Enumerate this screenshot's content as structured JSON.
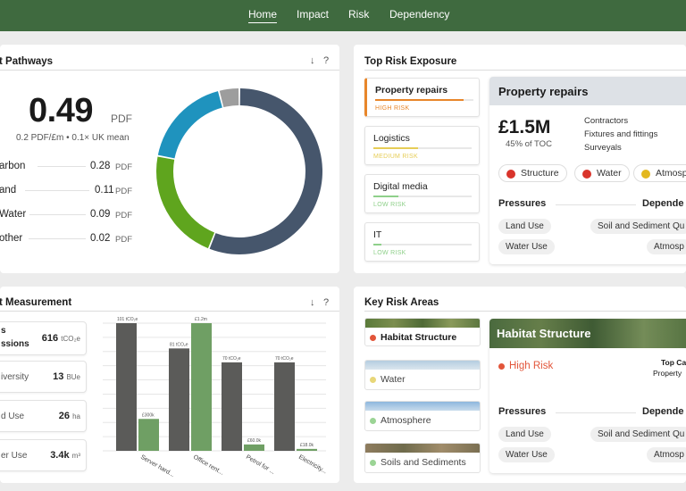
{
  "nav": {
    "items": [
      "Home",
      "Impact",
      "Risk",
      "Dependency"
    ]
  },
  "pathways": {
    "title": "t Pathways",
    "download_icon": "↓",
    "help_icon": "?",
    "big_value": "0.49",
    "big_unit": "PDF",
    "subtitle": "0.2 PDF/£m • 0.1× UK mean",
    "rows": [
      {
        "label": "arbon",
        "value": "0.28",
        "unit": "PDF"
      },
      {
        "label": "and",
        "value": "0.11",
        "unit": "PDF"
      },
      {
        "label": "Water",
        "value": "0.09",
        "unit": "PDF"
      },
      {
        "label": "other",
        "value": "0.02",
        "unit": "PDF"
      }
    ],
    "donut": {
      "segments": [
        {
          "value": 0.28,
          "color": "#46566c"
        },
        {
          "value": 0.11,
          "color": "#5fa51e"
        },
        {
          "value": 0.09,
          "color": "#1f93be"
        },
        {
          "value": 0.02,
          "color": "#9d9d9d"
        }
      ]
    }
  },
  "risk_exposure": {
    "title": "Top Risk Exposure",
    "tiles": [
      {
        "name": "Property repairs",
        "level": "HIGH RISK",
        "level_color": "#e8862a",
        "fill": 0.9,
        "active": true
      },
      {
        "name": "Logistics",
        "level": "MEDIUM RISK",
        "level_color": "#e6cd57",
        "fill": 0.45,
        "active": false
      },
      {
        "name": "Digital media",
        "level": "LOW RISK",
        "level_color": "#8fd08a",
        "fill": 0.25,
        "active": false
      },
      {
        "name": "IT",
        "level": "LOW RISK",
        "level_color": "#8fd08a",
        "fill": 0.08,
        "active": false
      }
    ],
    "detail": {
      "title": "Property repairs",
      "value": "£1.5M",
      "share": "45% of TOC",
      "subcategories": [
        "Contractors",
        "Fixtures and fittings",
        "Surveyals"
      ],
      "tags": [
        {
          "label": "Structure",
          "color": "#d9342b"
        },
        {
          "label": "Water",
          "color": "#d9342b"
        },
        {
          "label": "Atmosp",
          "color": "#e3b81f"
        }
      ],
      "pressures_label": "Pressures",
      "dependencies_label": "Depende",
      "pressure_chips": [
        "Land Use",
        "Water Use"
      ],
      "dependency_chips": [
        "Soil and Sediment Qu",
        "Atmosp"
      ]
    }
  },
  "measurement": {
    "title": "t Measurement",
    "download_icon": "↓",
    "help_icon": "?",
    "tiles": [
      {
        "label": "s",
        "label2": "ssions",
        "value": "616",
        "unit": "tCO₂e"
      },
      {
        "label": "iversity",
        "value": "13",
        "unit": "BUe"
      },
      {
        "label": "d Use",
        "value": "26",
        "unit": "ha"
      },
      {
        "label": "er Use",
        "value": "3.4k",
        "unit": "m³"
      }
    ]
  },
  "chart_data": {
    "type": "bar",
    "categories": [
      "Server hard...",
      "Office rent...",
      "Petrol for ...",
      "Electricity..."
    ],
    "series": [
      {
        "values": [
          101,
          81,
          70,
          70
        ],
        "color": "#5b5b59",
        "labels": [
          "101 tCO₂e",
          "81 tCO₂e",
          "70 tCO₂e",
          "70 tCO₂e"
        ]
      },
      {
        "values": [
          0.3,
          1.2,
          0.06,
          0.018
        ],
        "color": "#6f9f64",
        "labels": [
          "£300k",
          "£1.2m",
          "£60.0k",
          "£18.0k"
        ]
      }
    ],
    "grid": true,
    "title": "",
    "xlabel": "",
    "ylabel": ""
  },
  "key_risk": {
    "title": "Key Risk Areas",
    "tiles": [
      {
        "name": "Habitat Structure",
        "dot": "#e2553a",
        "bold": true,
        "image": "forest"
      },
      {
        "name": "Water",
        "dot": "#e8d779",
        "bold": false,
        "image": "sky"
      },
      {
        "name": "Atmosphere",
        "dot": "#9bd495",
        "bold": false,
        "image": "cloud"
      },
      {
        "name": "Soils and Sediments",
        "dot": "#9bd495",
        "bold": false,
        "image": "soil"
      }
    ],
    "detail": {
      "title": "Habitat Structure",
      "risk": "High Risk",
      "risk_color": "#e2553a",
      "top_label": "Top Ca",
      "top_value": "Property",
      "pressures_label": "Pressures",
      "dependencies_label": "Depende",
      "pressure_chips": [
        "Land Use",
        "Water Use"
      ],
      "dependency_chips": [
        "Soil and Sediment Qu",
        "Atmosp"
      ]
    }
  }
}
